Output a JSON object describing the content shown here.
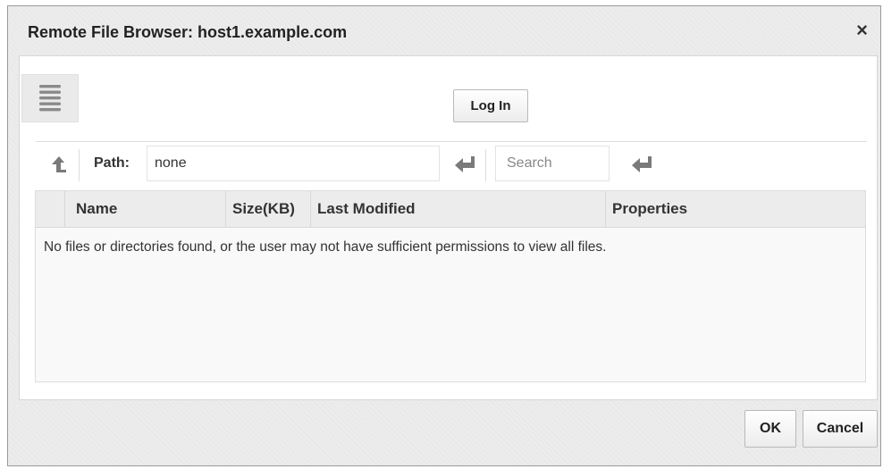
{
  "dialog": {
    "title": "Remote File Browser: host1.example.com",
    "close_label": "×"
  },
  "icons": {
    "menu": "hamburger-menu-icon",
    "up": "up-arrow-icon",
    "path_enter": "enter-return-icon",
    "search_enter": "enter-return-icon"
  },
  "toolbar": {
    "login_label": "Log In",
    "path_label": "Path:",
    "path_value": "none",
    "search_placeholder": "Search"
  },
  "table": {
    "columns": [
      "Name",
      "Size(KB)",
      "Last Modified",
      "Properties"
    ],
    "rows": [],
    "empty_message": "No files or directories found, or the user may not have sufficient permissions to view all files."
  },
  "footer": {
    "ok_label": "OK",
    "cancel_label": "Cancel"
  },
  "colors": {
    "icon_gray": "#8a8a8a",
    "header_bg": "#ececec",
    "dialog_bg": "#ececec"
  }
}
